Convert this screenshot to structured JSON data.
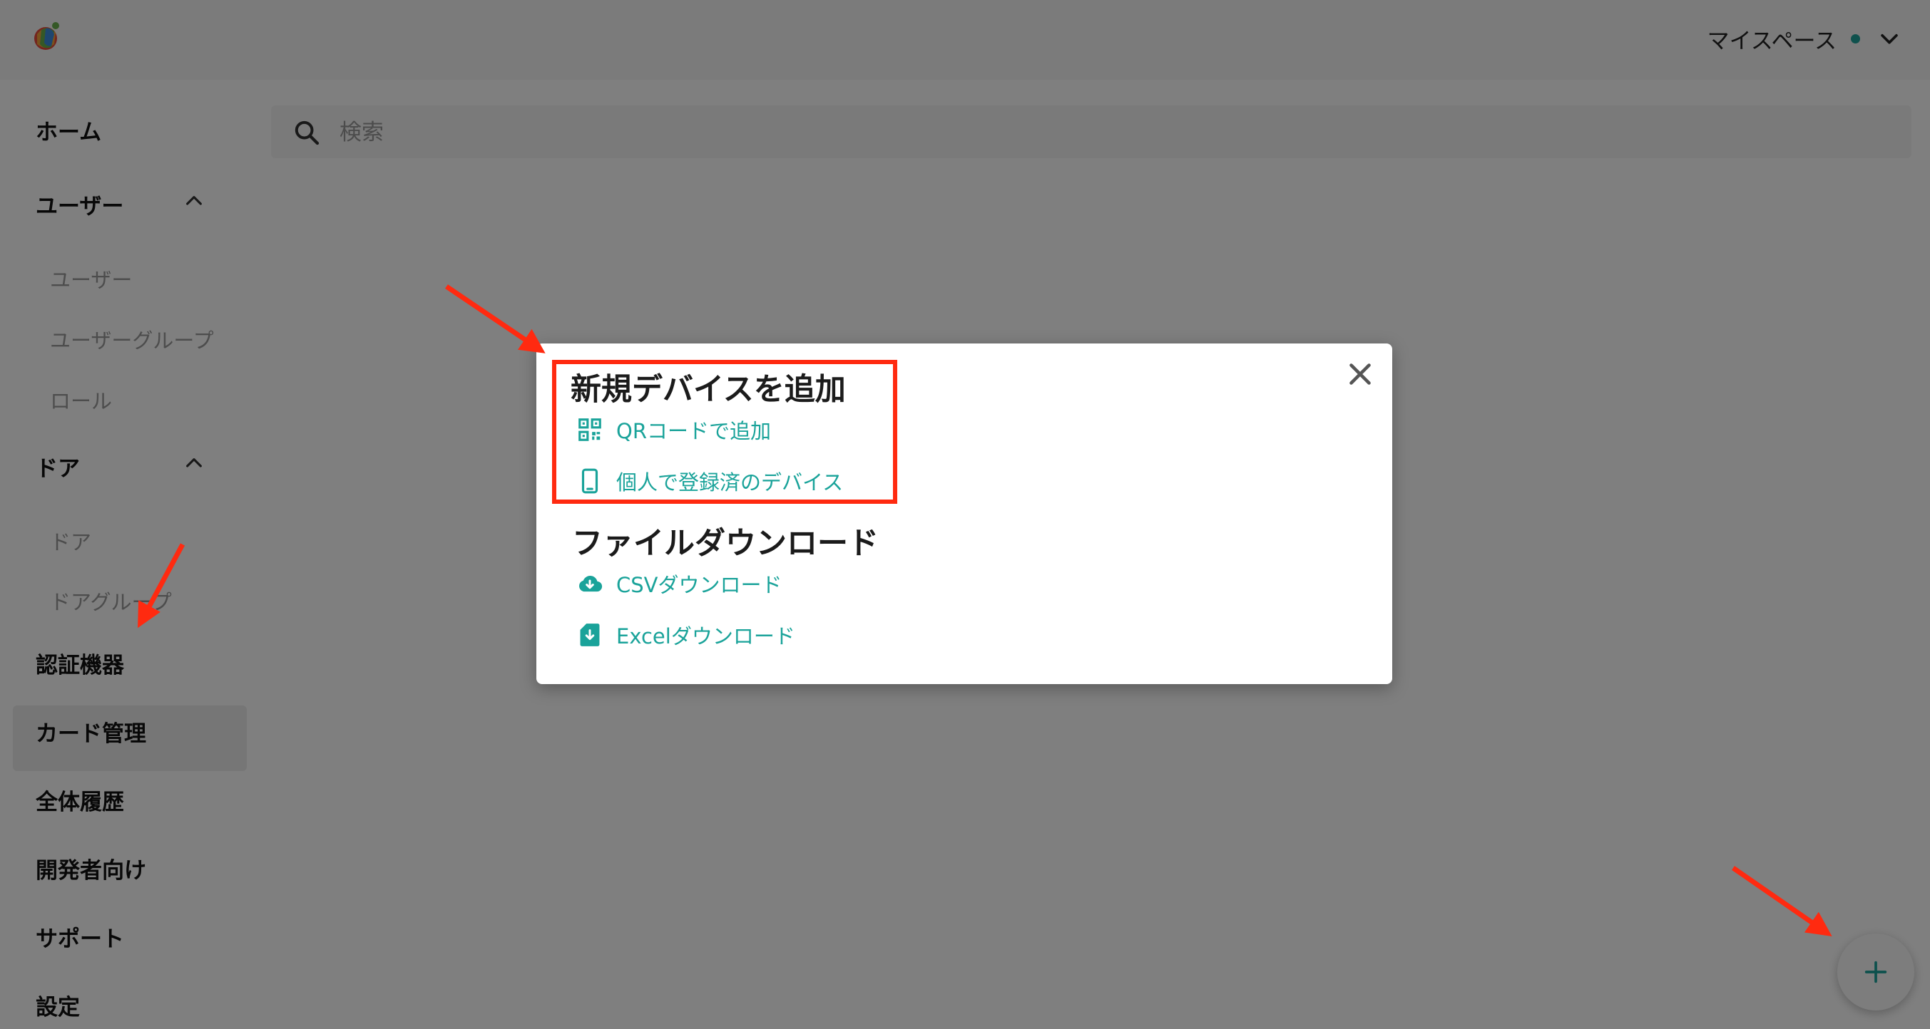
{
  "header": {
    "workspace_label": "マイスペース"
  },
  "sidebar": {
    "items": [
      {
        "label": "ホーム"
      },
      {
        "label": "ユーザー",
        "children": [
          "ユーザー",
          "ユーザーグループ",
          "ロール"
        ]
      },
      {
        "label": "ドア",
        "children": [
          "ドア",
          "ドアグループ"
        ]
      },
      {
        "label": "認証機器"
      },
      {
        "label": "カード管理"
      },
      {
        "label": "全体履歴"
      },
      {
        "label": "開発者向け"
      },
      {
        "label": "サポート"
      },
      {
        "label": "設定"
      }
    ]
  },
  "search": {
    "placeholder": "検索"
  },
  "modal": {
    "add_device": {
      "title": "新規デバイスを追加",
      "actions": [
        {
          "label": "QRコードで追加",
          "icon": "qr-code-icon"
        },
        {
          "label": "個人で登録済のデバイス",
          "icon": "smartphone-icon"
        }
      ]
    },
    "file_download": {
      "title": "ファイルダウンロード",
      "actions": [
        {
          "label": "CSVダウンロード",
          "icon": "cloud-download-icon"
        },
        {
          "label": "Excelダウンロード",
          "icon": "file-download-icon"
        }
      ]
    }
  },
  "colors": {
    "accent": "#1aa39a",
    "annotation": "#ff2a10",
    "overlay": "#000000"
  }
}
